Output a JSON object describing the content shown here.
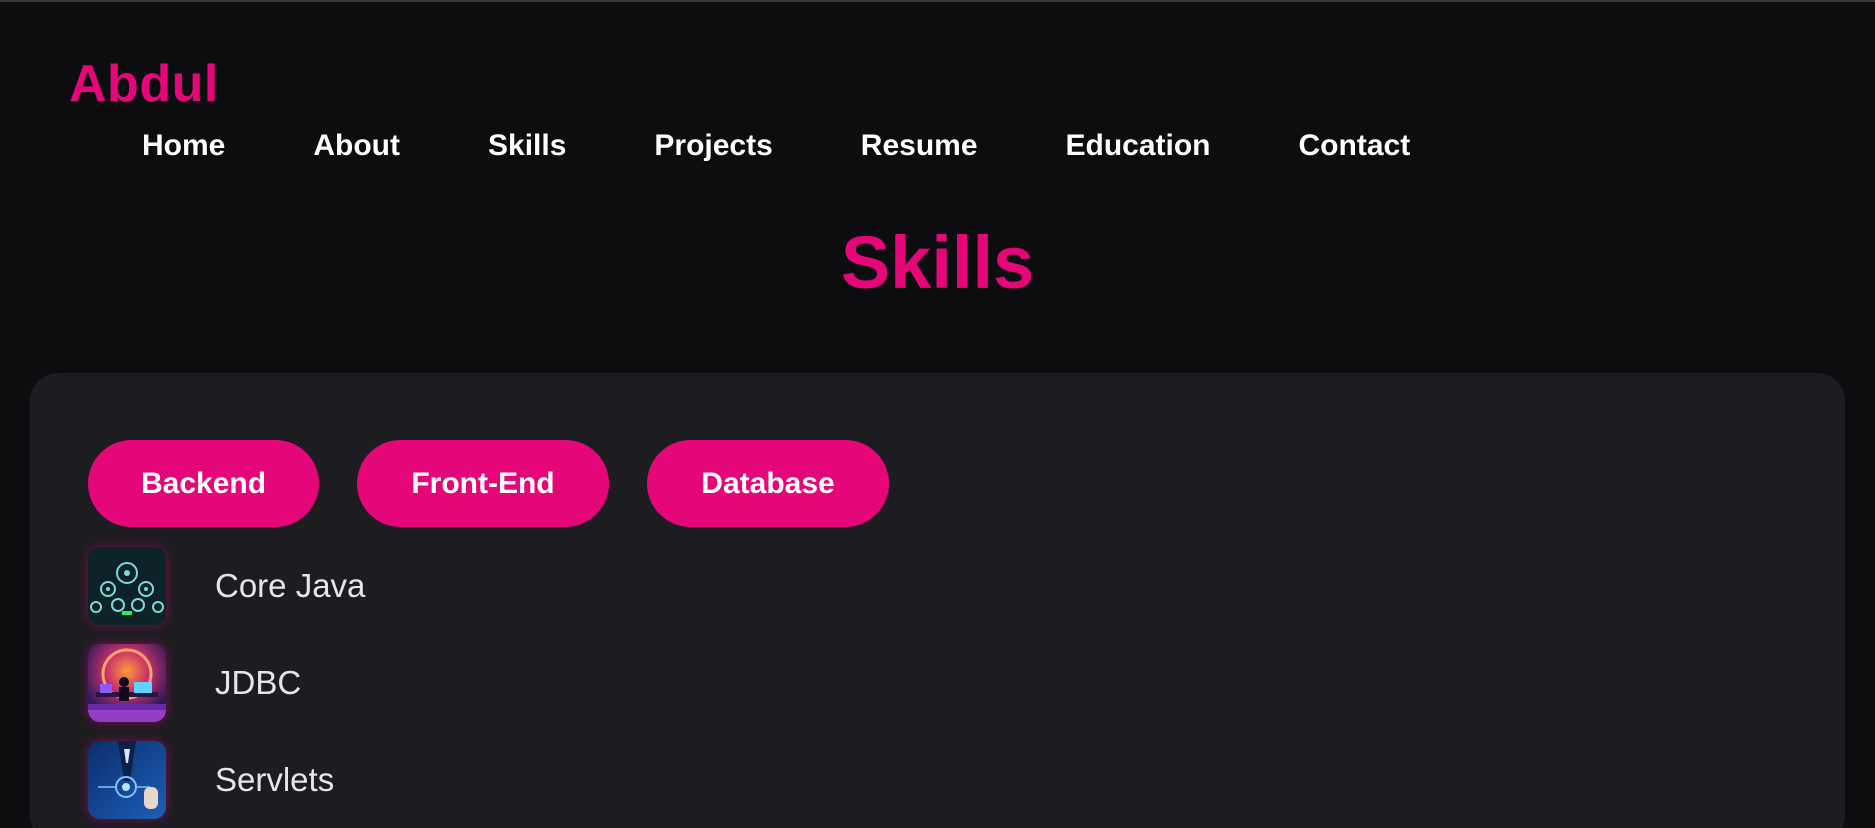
{
  "brand": {
    "name": "Abdul"
  },
  "nav": {
    "items": [
      {
        "label": "Home"
      },
      {
        "label": "About"
      },
      {
        "label": "Skills"
      },
      {
        "label": "Projects"
      },
      {
        "label": "Resume"
      },
      {
        "label": "Education"
      },
      {
        "label": "Contact"
      }
    ]
  },
  "section": {
    "title": "Skills"
  },
  "skills_panel": {
    "tabs": [
      {
        "label": "Backend"
      },
      {
        "label": "Front-End"
      },
      {
        "label": "Database"
      }
    ],
    "items": [
      {
        "label": "Core Java",
        "icon": "java-gears-image"
      },
      {
        "label": "JDBC",
        "icon": "neon-computer-image"
      },
      {
        "label": "Servlets",
        "icon": "tech-hand-image"
      }
    ]
  },
  "colors": {
    "accent": "#e5077a",
    "background": "#0d0d10",
    "panel": "#1d1c21"
  }
}
